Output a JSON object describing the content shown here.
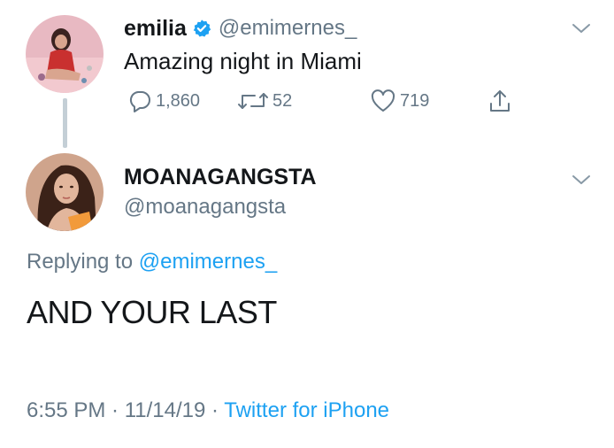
{
  "colors": {
    "text_primary": "#14171a",
    "text_secondary": "#657786",
    "link": "#1da1f2",
    "verified": "#1da1f2",
    "thread_line": "#c4cfd6"
  },
  "tweet": {
    "display_name": "emilia",
    "verified": true,
    "handle": "@emimernes_",
    "text": "Amazing night in Miami",
    "reply_count": "1,860",
    "retweet_count": "52",
    "like_count": "719",
    "icons": [
      "reply-icon",
      "retweet-icon",
      "like-icon",
      "share-icon",
      "chevron-down-icon",
      "verified-badge-icon"
    ]
  },
  "reply": {
    "display_name": "MOANAGANGSTA",
    "handle": "@moanagangsta",
    "replying_prefix": "Replying to ",
    "replying_to": "@emimernes_",
    "text": "AND YOUR LAST",
    "time": "6:55 PM",
    "date": "11/14/19",
    "separator": " · ",
    "source": "Twitter for iPhone"
  }
}
